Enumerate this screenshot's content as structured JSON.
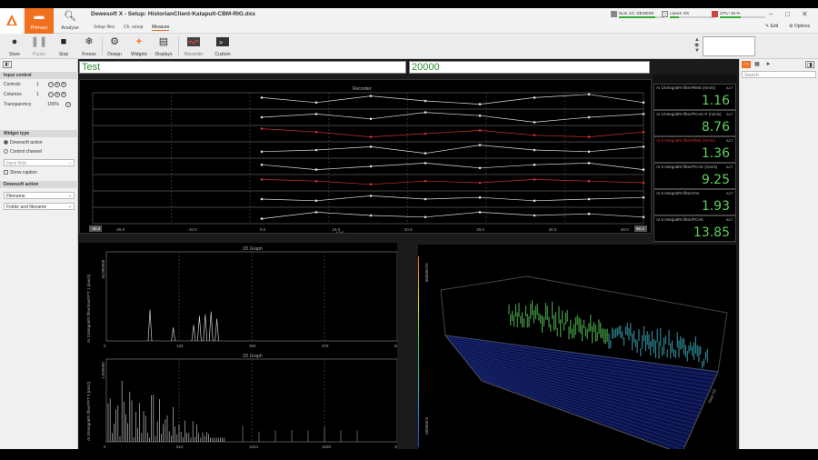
{
  "app": {
    "title": "Dewesoft X - Setup: HistorianClient-Katapult-CBM-RIG.dxs"
  },
  "main_tabs": [
    {
      "label": "Primary"
    },
    {
      "label": "Analyse"
    }
  ],
  "sub_tabs": [
    {
      "label": "Setup files"
    },
    {
      "label": "Ch. setup"
    },
    {
      "label": "Measure"
    }
  ],
  "status": [
    {
      "label": "Num 1/1: DEWE99"
    },
    {
      "label": "Lane3: 0/s"
    },
    {
      "label": "CPU: 46 %"
    }
  ],
  "window": {
    "edit": "Edit",
    "options": "Options"
  },
  "ribbon": [
    {
      "label": "Store",
      "icon": "store-icon"
    },
    {
      "label": "Pause",
      "icon": "pause-icon"
    },
    {
      "label": "Stop",
      "icon": "stop-icon"
    },
    {
      "label": "Freeze",
      "icon": "freeze-icon"
    },
    {
      "label": "Design",
      "icon": "gear-icon"
    },
    {
      "label": "Widgets",
      "icon": "plus-icon"
    },
    {
      "label": "Displays",
      "icon": "displays-icon"
    },
    {
      "label": "Recorder",
      "icon": "recorder-icon"
    },
    {
      "label": "Custom",
      "icon": "custom-icon"
    }
  ],
  "left_panel": {
    "input_control": {
      "title": "Input control",
      "controls_label": "Controls",
      "controls_value": "1",
      "columns_label": "Columns",
      "columns_value": "1",
      "transparency_label": "Transparency",
      "transparency_value": "100%"
    },
    "widget_type": {
      "title": "Widget type",
      "option1": "Dewesoft action",
      "option2": "Control channel",
      "input_field": "Input field",
      "show_caption": "Show caption"
    },
    "filename": {
      "title": "Dewesoft action",
      "opt1": "Filename",
      "opt2": "Folder and filename"
    }
  },
  "inputs": {
    "text1": "Test",
    "text2": "20000"
  },
  "recorder": {
    "title": "Recorder",
    "xaxis_label": "t (s)",
    "ticks": [
      "-25.0",
      "-10.0",
      "0.0",
      "10.0",
      "20.0",
      "30.0",
      "40.0",
      "50.0"
    ],
    "left_tick": "-33.2",
    "right_tick": "56.3"
  },
  "graph2d_1": {
    "title": "2D Graph",
    "ylabel": "AI 1/IntegralRI filter/rms/FFT 1 [mm/s]",
    "xticks": [
      "0",
      "125",
      "250",
      "375",
      "500"
    ],
    "top_tick": "10,000000"
  },
  "graph2d_2": {
    "title": "2D Graph",
    "ylabel": "AI 5/IntegralRI filter/FFT 0 [m/s2]",
    "xticks": [
      "0",
      "512",
      "1024",
      "1536",
      "2047"
    ],
    "top_tick": "1,000000"
  },
  "graph3d": {
    "colorbar_ticks": [
      "10,000000",
      "0,000000"
    ],
    "colorbar_label": "AI 1/IntegralRI filter/rms/FFT [mm/s]",
    "time_label": "Time (s)"
  },
  "digital_meters": [
    {
      "label": "AI 1/IntegralRI filter/RMS (mm/s)",
      "act": "ACT",
      "value": "1.16",
      "alarm": false
    },
    {
      "label": "AI 1/IntegralRI filter/PCAK-P (mm/s)",
      "act": "ACT",
      "value": "8.76",
      "alarm": false
    },
    {
      "label": "AI 5 IntegralRI filter/RMS (mm/s)",
      "act": "ACT",
      "value": "1.36",
      "alarm": true
    },
    {
      "label": "AI 5 IntegralRI filter/PCAK (mm/s)",
      "act": "ACT",
      "value": "9.25",
      "alarm": false
    },
    {
      "label": "AI 5 IntegralRI filter/rms",
      "act": "ACT",
      "value": "1.93",
      "alarm": false
    },
    {
      "label": "AI 5 IntegralRI filter/PCAK",
      "act": "ACT",
      "value": "13.85",
      "alarm": false
    }
  ],
  "right_panel": {
    "search_placeholder": "Search"
  },
  "colors": {
    "accent": "#f07020",
    "meter_value": "#5cd05c",
    "alarm_label": "#d03030"
  }
}
